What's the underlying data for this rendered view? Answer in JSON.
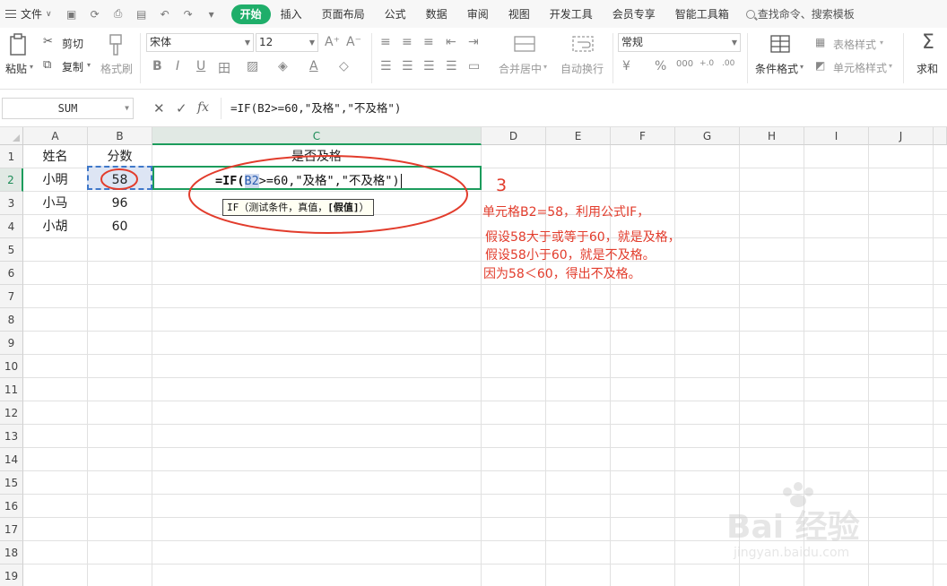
{
  "menubar": {
    "file_label": "文件",
    "tabs": [
      "开始",
      "插入",
      "页面布局",
      "公式",
      "数据",
      "审阅",
      "视图",
      "开发工具",
      "会员专享",
      "智能工具箱"
    ],
    "active_tab": "开始",
    "search_placeholder": "查找命令、搜索模板"
  },
  "ribbon": {
    "paste": "粘贴",
    "cut": "剪切",
    "copy": "复制",
    "format_painter": "格式刷",
    "font_name": "宋体",
    "font_size": "12",
    "merge_center": "合并居中",
    "wrap_text": "自动换行",
    "number_format": "常规",
    "conditional_format": "条件格式",
    "table_style": "表格样式",
    "cell_style": "单元格样式",
    "sum": "求和",
    "accent_color": "#1fae6a"
  },
  "formula_bar": {
    "name_box": "SUM",
    "formula": "=IF(B2>=60,\"及格\",\"不及格\")"
  },
  "grid": {
    "columns": [
      "A",
      "B",
      "C",
      "D",
      "E",
      "F",
      "G",
      "H",
      "I",
      "J"
    ],
    "rows": [
      "1",
      "2",
      "3",
      "4",
      "5",
      "6",
      "7",
      "8",
      "9",
      "10",
      "11",
      "12",
      "13",
      "14",
      "15",
      "16",
      "17",
      "18",
      "19"
    ],
    "cells": {
      "A1": "姓名",
      "B1": "分数",
      "C1": "是否及格",
      "A2": "小明",
      "B2": "58",
      "A3": "小马",
      "B3": "96",
      "A4": "小胡",
      "B4": "60"
    },
    "editing": {
      "prefix": "=IF(",
      "ref": "B2",
      "rest": ">=60,\"及格\",\"不及格\")"
    },
    "tooltip": {
      "fn": "IF",
      "args": "（测试条件，真值，",
      "bold_arg": "[假值]",
      "close": "）"
    }
  },
  "annotation": {
    "step_number": "3",
    "lines": [
      "单元格B2=58，利用公式IF，",
      "假设58大于或等于60，就是及格，",
      "假设58小于60，就是不及格。",
      "因为58＜60，得出不及格。"
    ],
    "color": "#e23c2c"
  },
  "watermark": {
    "brand": "Bai 经验",
    "url": "jingyan.baidu.com"
  }
}
